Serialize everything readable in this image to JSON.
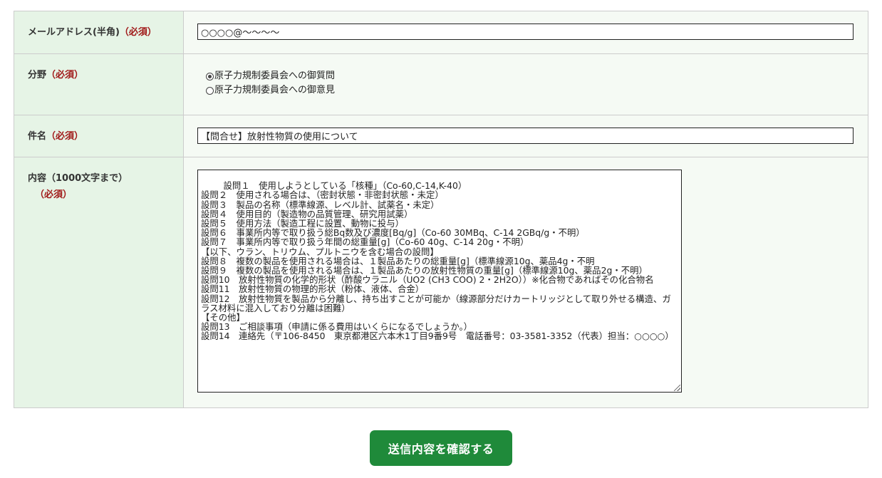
{
  "form": {
    "email": {
      "label": "メールアドレス(半角)",
      "required": "（必須）",
      "value": "○○○○@～～～～"
    },
    "field": {
      "label": "分野",
      "required": "（必須）",
      "options": [
        {
          "label": "原子力規制委員会への御質問",
          "checked": true
        },
        {
          "label": "原子力規制委員会への御意見",
          "checked": false
        }
      ]
    },
    "subject": {
      "label": "件名",
      "required": "（必須）",
      "value": "【問合せ】放射性物質の使用について"
    },
    "content": {
      "label": "内容（1000文字まで）",
      "required": "（必須）",
      "value": "設問１　使用しようとしている「核種」（Co-60,C-14,K-40）\n設問２　使用される場合は、（密封状態・非密封状態・未定）\n設問３　製品の名称（標準線源、レベル計、試薬名・未定）\n設問４　使用目的（製造物の品質管理、研究用試薬）\n設問５　使用方法（製造工程に設置、動物に投与）\n設問６　事業所内等で取り扱う総Bq数及び濃度[Bq/g]（Co-60 30MBq、C-14 2GBq/g・不明）\n設問７　事業所内等で取り扱う年間の総重量[g]（Co-60 40g、C-14 20g・不明）\n【以下、ウラン、トリウム、プルトニウを含む場合の設問】\n設問８　複数の製品を使用される場合は、１製品あたりの総重量[g]（標準線源10g、薬品4g・不明\n設問９　複数の製品を使用される場合は、１製品あたりの放射性物質の重量[g]（標準線源10g、薬品2g・不明）\n設問10　放射性物質の化学的形状（酢酸ウラニル（UO2 (CH3 COO) 2・2H2O））※化合物であればその化合物名\n設問11　放射性物質の物理的形状（粉体、液体、合金）\n設問12　放射性物質を製品から分離し、持ち出すことが可能か（線源部分だけカートリッジとして取り外せる構造、ガラス材料に混入しており分離は困難）\n【その他】\n設問13　ご相談事項（申請に係る費用はいくらになるでしょうか。）\n設問14　連絡先（〒106-8450　東京都港区六本木1丁目9番9号　電話番号：03-3581-3352（代表）担当：○○○○）"
    },
    "submit_label": "送信内容を確認する"
  }
}
